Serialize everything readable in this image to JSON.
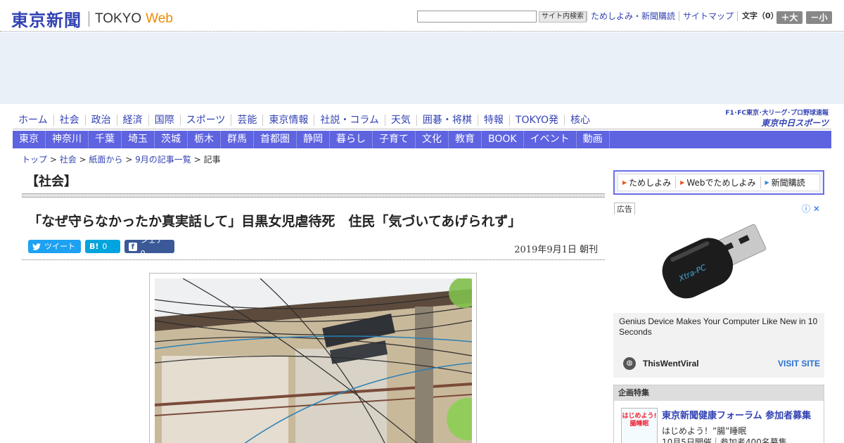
{
  "header": {
    "logo_jp": "東京新聞",
    "logo_en": "TOKYO",
    "logo_web": "Web",
    "search_placeholder": "",
    "search_button": "サイト内検索",
    "links": [
      "ためしよみ・新聞購読",
      "サイトマップ"
    ],
    "textsize_label": "文字（0）",
    "size_up": "＋大",
    "size_down": "－小"
  },
  "nav_primary": [
    "ホーム",
    "社会",
    "政治",
    "経済",
    "国際",
    "スポーツ",
    "芸能",
    "東京情報",
    "社説・コラム",
    "天気",
    "囲碁・将棋",
    "特報",
    "TOKYO発",
    "核心"
  ],
  "sports_logo": {
    "top": "F1･FC東京･大リーグ･プロ野球速報",
    "bottom": "東京中日スポーツ"
  },
  "nav_secondary": [
    "東京",
    "神奈川",
    "千葉",
    "埼玉",
    "茨城",
    "栃木",
    "群馬",
    "首都圏",
    "静岡",
    "暮らし",
    "子育て",
    "文化",
    "教育",
    "BOOK",
    "イベント",
    "動画"
  ],
  "breadcrumb": {
    "items": [
      "トップ",
      "社会",
      "紙面から",
      "9月の記事一覧"
    ],
    "current": "記事",
    "sep": " > "
  },
  "article": {
    "section": "【社会】",
    "headline": "「なぜ守らなかったか真実話して」目黒女児虐待死　住民「気づいてあげられず」",
    "date": "2019年9月1日 朝刊",
    "share": {
      "tweet": {
        "label": "ツイート",
        "icon": "twitter-icon"
      },
      "hatena": {
        "label": "0",
        "icon_text": "B!"
      },
      "facebook": {
        "label": "シェア 0",
        "icon_text": "f"
      }
    }
  },
  "sidebar": {
    "subscribe": [
      "ためしよみ",
      "Webでためしよみ",
      "新聞購読"
    ],
    "ad_label": "広告",
    "ad": {
      "headline": "Genius Device Makes Your Computer Like New in 10 Seconds",
      "source": "ThisWentViral",
      "cta": "VISIT SITE",
      "product_text": "Xtra-PC"
    },
    "feature": {
      "title": "企画特集",
      "thumb_text": "はじめよう!腸睡眠",
      "link": "東京新聞健康フォーラム 参加者募集",
      "sub": "はじめよう！”腸”睡眠",
      "sub2": "10月5日開催｜参加者400名募集"
    }
  },
  "colors": {
    "brand": "#3343b3",
    "nav_bar": "#5e63e0",
    "accent_web": "#f08a00"
  }
}
